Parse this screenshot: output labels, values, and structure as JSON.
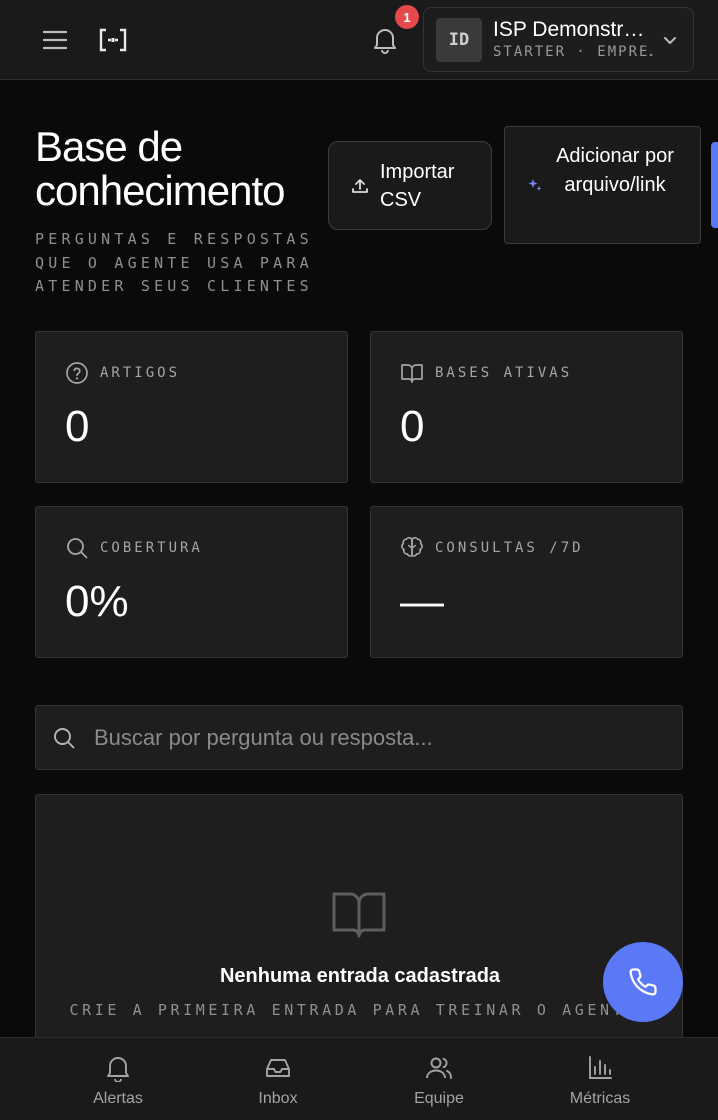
{
  "header": {
    "notification_count": "1",
    "account": {
      "initials": "ID",
      "name": "ISP Demonstr…",
      "plan": "STARTER · EMPRE…"
    }
  },
  "page": {
    "title": "Base de conhecimento",
    "subtitle": "PERGUNTAS E RESPOSTAS QUE O AGENTE USA PARA ATENDER SEUS CLIENTES",
    "import_button": "Importar CSV",
    "add_button": "Adicionar por arquivo/link"
  },
  "stats": [
    {
      "label": "ARTIGOS",
      "value": "0",
      "icon": "help-circle-icon"
    },
    {
      "label": "BASES ATIVAS",
      "value": "0",
      "icon": "book-open-icon"
    },
    {
      "label": "COBERTURA",
      "value": "0%",
      "icon": "search-icon"
    },
    {
      "label": "CONSULTAS /7D",
      "value": "—",
      "icon": "brain-icon"
    }
  ],
  "search": {
    "placeholder": "Buscar por pergunta ou resposta...",
    "value": ""
  },
  "empty_state": {
    "title": "Nenhuma entrada cadastrada",
    "subtitle": "CRIE A PRIMEIRA ENTRADA PARA TREINAR O AGENTE."
  },
  "bottom_nav": [
    {
      "label": "Alertas",
      "icon": "bell-icon"
    },
    {
      "label": "Inbox",
      "icon": "inbox-icon"
    },
    {
      "label": "Equipe",
      "icon": "users-icon"
    },
    {
      "label": "Métricas",
      "icon": "bar-chart-icon"
    }
  ],
  "colors": {
    "background": "#0a0a0a",
    "surface": "#1e1e1e",
    "accent": "#5b78f6",
    "badge": "#e5484d"
  }
}
